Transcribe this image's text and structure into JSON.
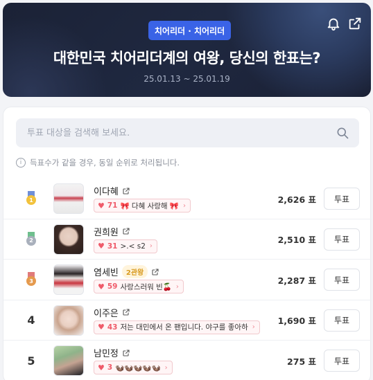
{
  "banner": {
    "category": "치어리더 · 치어리더",
    "title": "대한민국 치어리더계의 여왕, 당신의 한표는?",
    "date_range": "25.01.13 ~ 25.01.19",
    "icons": [
      "bell-icon",
      "share-icon"
    ]
  },
  "search": {
    "placeholder": "투표 대상을 검색해 보세요."
  },
  "notice": "득표수가 같을 경우, 동일 순위로 처리됩니다.",
  "colors": {
    "accent": "#3a63e6",
    "cheer": "#ef5b6a",
    "gold": "#f2c23c",
    "silver": "#a9b0bc",
    "bronze": "#e59a4e"
  },
  "candidates": [
    {
      "rank": "1",
      "name": "이다혜",
      "badge": "",
      "cheer_count": "71",
      "cheer_text": "🎀 다혜 사랑해 🎀",
      "votes": "2,626 표",
      "vote_label": "투표"
    },
    {
      "rank": "2",
      "name": "권희원",
      "badge": "",
      "cheer_count": "31",
      "cheer_text": ">.< s2",
      "votes": "2,510 표",
      "vote_label": "투표"
    },
    {
      "rank": "3",
      "name": "염세빈",
      "badge": "2관왕",
      "cheer_count": "59",
      "cheer_text": "사랑스러워 빈🍒",
      "votes": "2,287 표",
      "vote_label": "투표"
    },
    {
      "rank": "4",
      "name": "이주은",
      "badge": "",
      "cheer_count": "43",
      "cheer_text": "저는 대민에서 온 팬입니다. 야구를 좋아하",
      "votes": "1,690 표",
      "vote_label": "투표"
    },
    {
      "rank": "5",
      "name": "남민정",
      "badge": "",
      "cheer_count": "3",
      "cheer_text": "🦦🦦🦦🦦🦦",
      "votes": "275 표",
      "vote_label": "투표"
    }
  ]
}
